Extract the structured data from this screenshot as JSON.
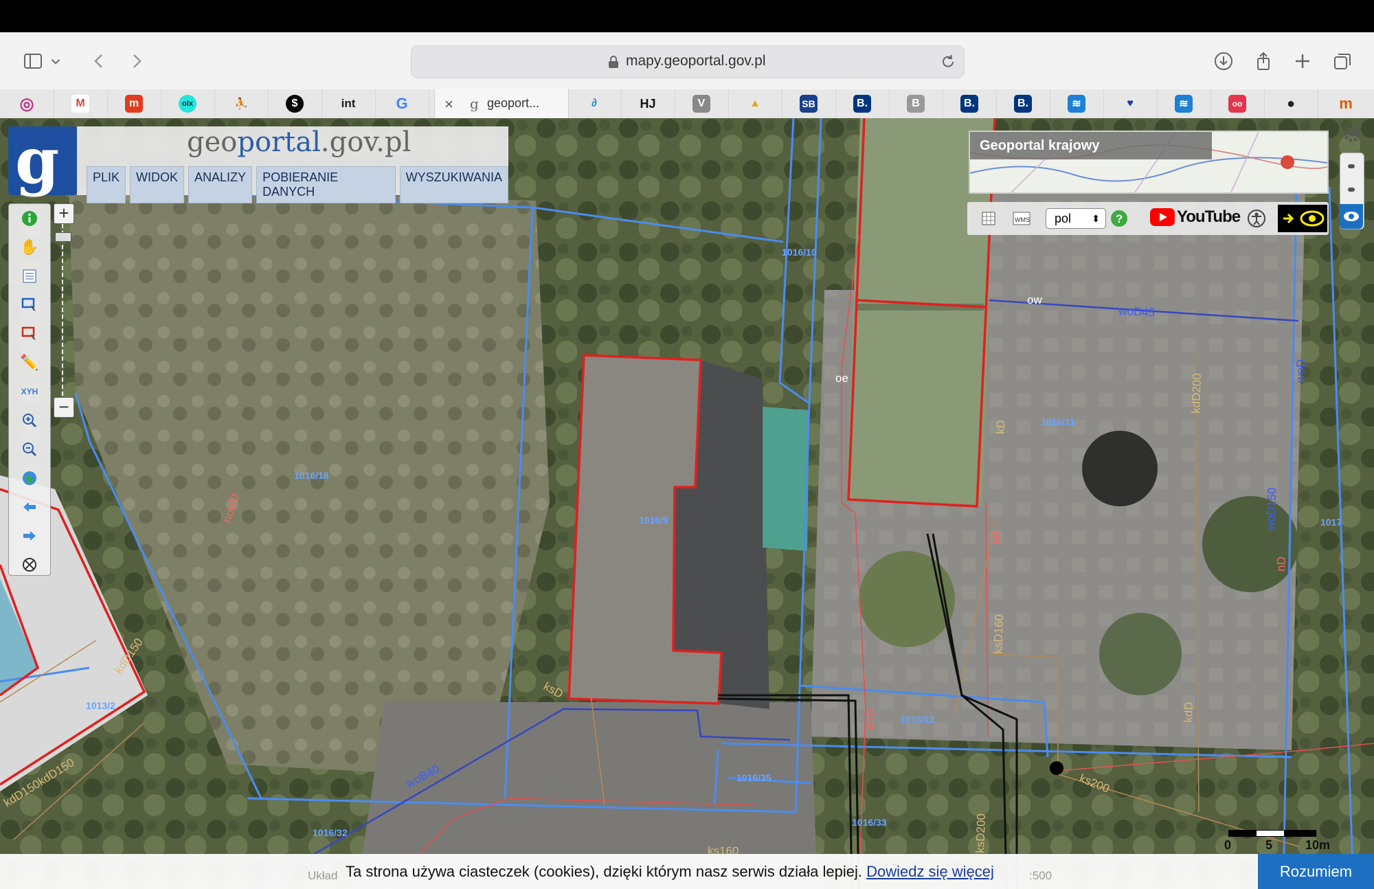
{
  "browser": {
    "url": "mapy.geoportal.gov.pl",
    "active_tab_title": "geoport...",
    "favorites": [
      {
        "icon": "instagram-icon",
        "glyph": "◎",
        "color": "#c13584"
      },
      {
        "icon": "gmail-icon",
        "glyph": "M",
        "color": "#d44638"
      },
      {
        "icon": "mbank-icon",
        "glyph": "m",
        "color": "#e03c1f"
      },
      {
        "icon": "olx-icon",
        "glyph": "olx",
        "color": "#23e5db"
      },
      {
        "icon": "run-icon",
        "glyph": "⛹",
        "color": "#777"
      },
      {
        "icon": "dollar-icon",
        "glyph": "$",
        "color": "#000"
      },
      {
        "icon": "int-icon",
        "glyph": "int",
        "color": "#1a1a1a"
      },
      {
        "icon": "google-icon",
        "glyph": "G",
        "color": "#4285f4"
      }
    ],
    "favorites_right": [
      {
        "icon": "swirl-icon",
        "glyph": "∂",
        "color": "#1f88c9"
      },
      {
        "icon": "hj-icon",
        "glyph": "HJ",
        "color": "#111"
      },
      {
        "icon": "v-icon",
        "glyph": "V",
        "color": "#777"
      },
      {
        "icon": "mountain-icon",
        "glyph": "▲",
        "color": "#e0a814"
      },
      {
        "icon": "sb-icon",
        "glyph": "SB",
        "color": "#1b3f8b"
      },
      {
        "icon": "booking-icon",
        "glyph": "B.",
        "color": "#003580"
      },
      {
        "icon": "b-gray-icon",
        "glyph": "B",
        "color": "#888"
      },
      {
        "icon": "booking-icon-2",
        "glyph": "B.",
        "color": "#003580"
      },
      {
        "icon": "booking-icon-3",
        "glyph": "B.",
        "color": "#003580"
      },
      {
        "icon": "sea-icon",
        "glyph": "≋",
        "color": "#1e7fd6"
      },
      {
        "icon": "shield-bird-icon",
        "glyph": "♥",
        "color": "#1c3c8c"
      },
      {
        "icon": "sea-icon-2",
        "glyph": "≋",
        "color": "#1e7fd6"
      },
      {
        "icon": "tripadvisor-icon",
        "glyph": "oo",
        "color": "#e2364d"
      },
      {
        "icon": "circle-icon",
        "glyph": "●",
        "color": "#222"
      },
      {
        "icon": "m-icon",
        "glyph": "m",
        "color": "#e05a00"
      }
    ]
  },
  "geoportal": {
    "site_prefix": "geo",
    "site_mid": "portal",
    "site_suffix": ".gov.pl",
    "menu": [
      "PLIK",
      "WIDOK",
      "ANALIZY",
      "POBIERANIE DANYCH",
      "WYSZUKIWANIA"
    ],
    "overview_label": "Geoportal krajowy",
    "language": "pol",
    "youtube_label": "YouTube"
  },
  "map_labels": [
    {
      "text": "1016/10",
      "color": "#6aa3ff"
    },
    {
      "text": "1016/18",
      "color": "#6aa3ff"
    },
    {
      "text": "1016/9",
      "color": "#6aa3ff"
    },
    {
      "text": "1016/11",
      "color": "#6aa3ff"
    },
    {
      "text": "1016/12",
      "color": "#6aa3ff"
    },
    {
      "text": "1016/35",
      "color": "#6aa3ff"
    },
    {
      "text": "1016/33",
      "color": "#6aa3ff"
    },
    {
      "text": "1016/32",
      "color": "#6aa3ff"
    },
    {
      "text": "1013/2",
      "color": "#6aa3ff"
    },
    {
      "text": "1017",
      "color": "#6aa3ff"
    },
    {
      "text": "woD45",
      "color": "#3b5cff"
    },
    {
      "text": "woB40",
      "color": "#3b5cff"
    },
    {
      "text": "woD150",
      "color": "#3b5cff"
    },
    {
      "text": "woD",
      "color": "#3b5cff"
    },
    {
      "text": "kdD200",
      "color": "#d8b978"
    },
    {
      "text": "kdD150",
      "color": "#d8b978"
    },
    {
      "text": "kdD",
      "color": "#d8b978"
    },
    {
      "text": "ksD",
      "color": "#d8b978"
    },
    {
      "text": "ksD200",
      "color": "#d8b978"
    },
    {
      "text": "ks200",
      "color": "#d8b978"
    },
    {
      "text": "ksD160",
      "color": "#d8b978"
    },
    {
      "text": "kD",
      "color": "#d8b978"
    },
    {
      "text": "ow",
      "color": "#fff"
    },
    {
      "text": "oe",
      "color": "#fff"
    },
    {
      "text": "en",
      "color": "#ff6060"
    },
    {
      "text": "enD",
      "color": "#ff6060"
    },
    {
      "text": "nD",
      "color": "#ff6060"
    },
    {
      "text": "nowD",
      "color": "#ff6060"
    },
    {
      "text": "kdD150kdD150",
      "color": "#d8b978"
    },
    {
      "text": "ks160",
      "color": "#d8b978"
    }
  ],
  "scale": {
    "zero": "0",
    "five": "5",
    "ten": "10m"
  },
  "cookie": {
    "message": "Ta strona używa ciasteczek (cookies), dzięki którym nasz serwis działa lepiej.",
    "link": "Dowiedz się więcej",
    "accept": "Rozumiem",
    "under_left": "Układ",
    "under_right": ":500"
  }
}
